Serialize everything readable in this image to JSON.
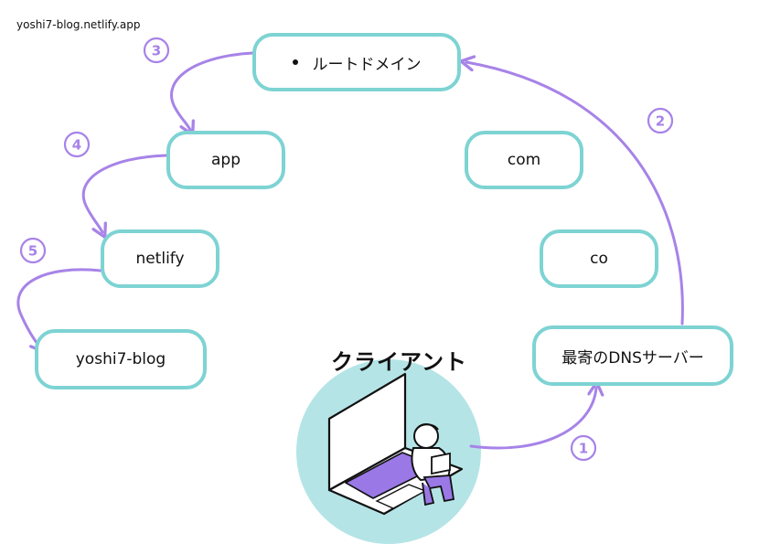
{
  "header": {
    "url": "yoshi7-blog.netlify.app"
  },
  "nodes": {
    "root": "ルートドメイン",
    "app": "app",
    "com": "com",
    "netlify": "netlify",
    "co": "co",
    "yoshi7_blog": "yoshi7-blog",
    "dns": "最寄のDNSサーバー"
  },
  "client": {
    "label": "クライアント"
  },
  "steps": [
    "1",
    "2",
    "3",
    "4",
    "5"
  ],
  "colors": {
    "node_border": "#7ed3d3",
    "arrow": "#a783e8",
    "client_circle": "#b4e4e6",
    "laptop_keyboard": "#9a78e6"
  }
}
